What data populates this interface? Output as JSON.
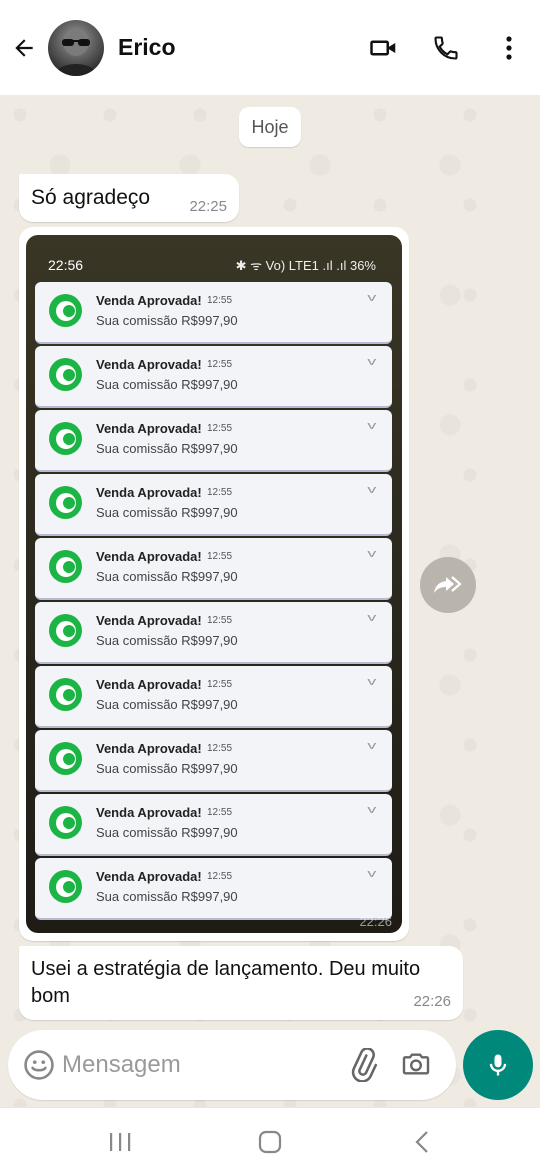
{
  "header": {
    "contact_name": "Erico",
    "icons": [
      "back-arrow-icon",
      "avatar",
      "video-call-icon",
      "phone-icon",
      "more-vertical-icon"
    ]
  },
  "chat": {
    "date_chip": "Hoje",
    "messages": [
      {
        "text": "Só agradeço",
        "time": "22:25"
      },
      {
        "text": "Usei  a estratégia de lançamento. Deu muito bom",
        "time": "22:26"
      }
    ],
    "image_message": {
      "status_time": "22:56",
      "status_battery": "36%",
      "status_icons": "✱ ᯤ Vo) LTE1 .ıl .ıl",
      "overlay_time": "22:26",
      "notifications": [
        {
          "title": "Venda Aprovada!",
          "time": "12:55",
          "body": "Sua comissão R$997,90"
        },
        {
          "title": "Venda Aprovada!",
          "time": "12:55",
          "body": "Sua comissão R$997,90"
        },
        {
          "title": "Venda Aprovada!",
          "time": "12:55",
          "body": "Sua comissão R$997,90"
        },
        {
          "title": "Venda Aprovada!",
          "time": "12:55",
          "body": "Sua comissão R$997,90"
        },
        {
          "title": "Venda Aprovada!",
          "time": "12:55",
          "body": "Sua comissão R$997,90"
        },
        {
          "title": "Venda Aprovada!",
          "time": "12:55",
          "body": "Sua comissão R$997,90"
        },
        {
          "title": "Venda Aprovada!",
          "time": "12:55",
          "body": "Sua comissão R$997,90"
        },
        {
          "title": "Venda Aprovada!",
          "time": "12:55",
          "body": "Sua comissão R$997,90"
        },
        {
          "title": "Venda Aprovada!",
          "time": "12:55",
          "body": "Sua comissão R$997,90"
        },
        {
          "title": "Venda Aprovada!",
          "time": "12:55",
          "body": "Sua comissão R$997,90"
        }
      ]
    }
  },
  "composer": {
    "placeholder": "Mensagem",
    "accent_color": "#00897b"
  }
}
